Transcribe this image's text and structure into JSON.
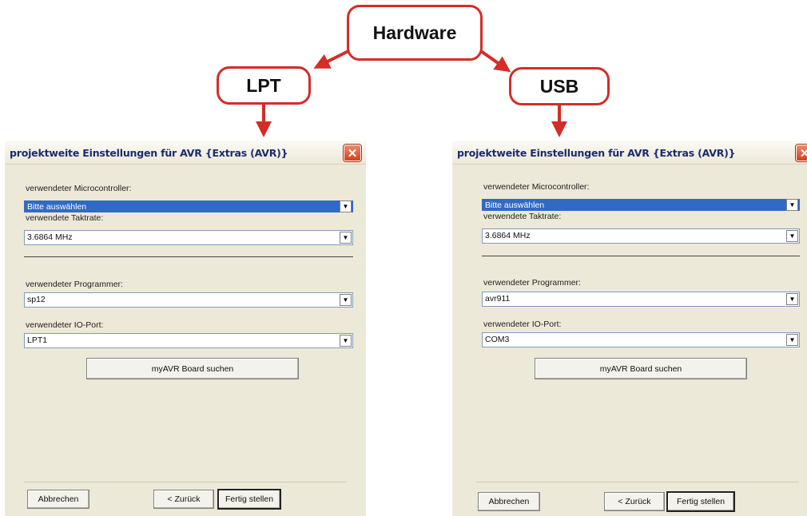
{
  "diagram": {
    "root": "Hardware",
    "left": "LPT",
    "right": "USB",
    "arrow_color": "#d42d27"
  },
  "dialog_lpt": {
    "title": "projektweite Einstellungen für AVR {Extras (AVR)}",
    "close_glyph": "✕",
    "mcu_label": "verwendeter Microcontroller:",
    "mcu_value": "Bitte auswählen",
    "clock_label": "verwendete Taktrate:",
    "clock_value": "3.6864 MHz",
    "programmer_label": "verwendeter Programmer:",
    "programmer_value": "sp12",
    "port_label": "verwendeter IO-Port:",
    "port_value": "LPT1",
    "search_button": "myAVR Board suchen",
    "cancel_button": "Abbrechen",
    "back_button": "< Zurück",
    "finish_button": "Fertig stellen"
  },
  "dialog_usb": {
    "title": "projektweite Einstellungen für AVR {Extras (AVR)}",
    "close_glyph": "✕",
    "mcu_label": "verwendeter Microcontroller:",
    "mcu_value": "Bitte auswählen",
    "clock_label": "verwendete Taktrate:",
    "clock_value": "3.6864 MHz",
    "programmer_label": "verwendeter Programmer:",
    "programmer_value": "avr911",
    "port_label": "verwendeter IO-Port:",
    "port_value": "COM3",
    "search_button": "myAVR Board suchen",
    "cancel_button": "Abbrechen",
    "back_button": "< Zurück",
    "finish_button": "Fertig stellen"
  },
  "icons": {
    "dropdown": "▼"
  }
}
